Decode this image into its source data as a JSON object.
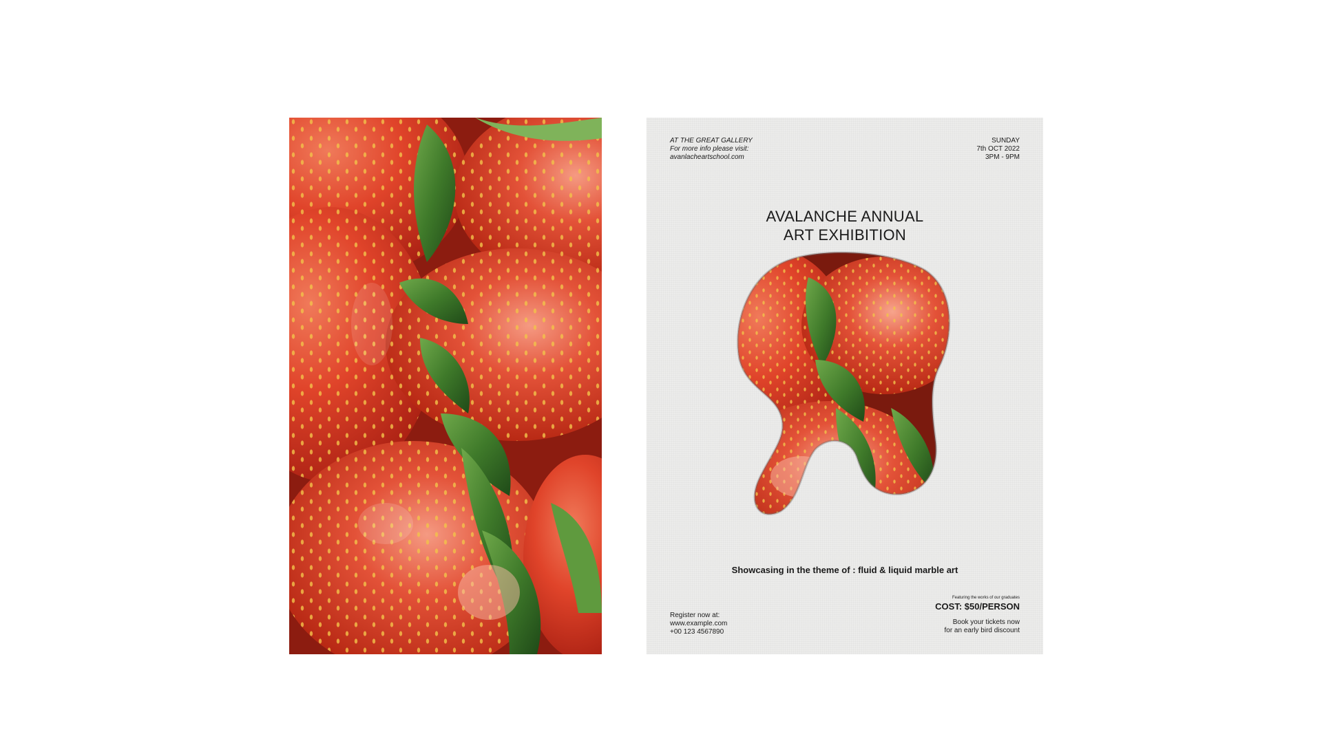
{
  "poster": {
    "venue": "AT THE GREAT GALLERY",
    "info_prompt": "For more info please visit:",
    "website": "avanlacheartschool.com",
    "day": "SUNDAY",
    "date": "7th OCT 2022",
    "time": "3PM - 9PM",
    "title_line1": "AVALANCHE ANNUAL",
    "title_line2": "ART EXHIBITION",
    "theme": "Showcasing in the theme of : fluid & liquid marble art",
    "register_label": "Register now at:",
    "register_url": "www.example.com",
    "phone": "+00 123 4567890",
    "featuring": "Featuring the works of our graduates",
    "cost": "COST: $50/PERSON",
    "book_line1": "Book your tickets now",
    "book_line2": "for an early bird discount"
  },
  "colors": {
    "background": "#ffffff",
    "poster_paper": "#ececeb",
    "strawberry_red": "#d33a22",
    "leaf_green": "#3f7a2a",
    "text": "#1a1a1a"
  },
  "artwork": {
    "subject": "painted-strawberries"
  }
}
